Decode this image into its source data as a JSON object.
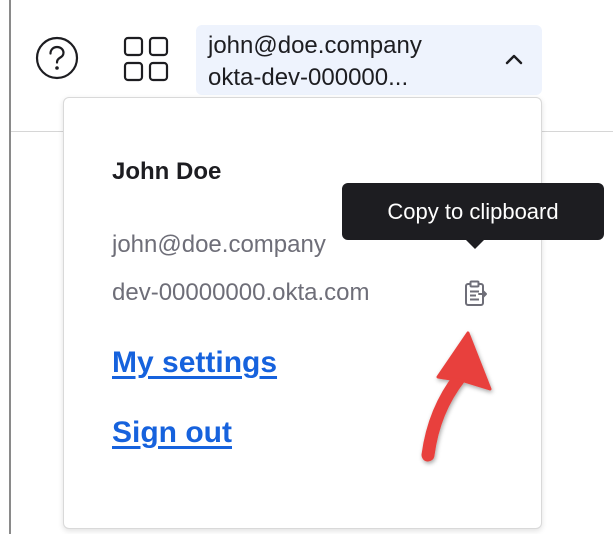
{
  "header": {
    "help_icon": "question-circle-icon",
    "apps_icon": "grid-icon",
    "account": {
      "email": "john@doe.company",
      "org": "okta-dev-000000...",
      "chevron_icon": "chevron-up-icon"
    }
  },
  "dropdown": {
    "name": "John Doe",
    "email": "john@doe.company",
    "domain": "dev-00000000.okta.com",
    "copy_icon": "clipboard-icon",
    "tooltip": "Copy to clipboard",
    "links": {
      "settings": "My settings",
      "signout": "Sign out"
    }
  },
  "colors": {
    "link": "#1662dd",
    "tooltip_bg": "#1d1d21",
    "account_bg": "#eef3fd",
    "annotation_arrow": "#e8403c"
  }
}
